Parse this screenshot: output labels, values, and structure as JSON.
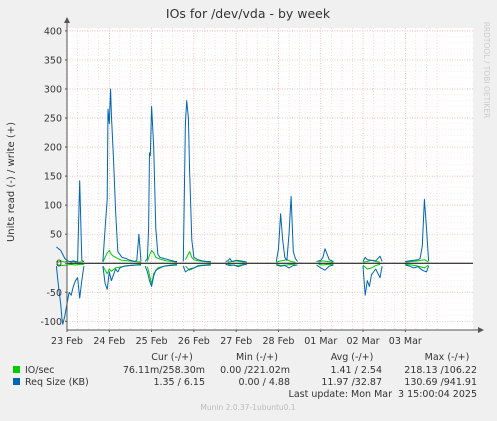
{
  "chart_data": {
    "type": "line",
    "title": "IOs for /dev/vda - by week",
    "ylabel": "Units read (-) / write (+)",
    "side_label": "RRDTOOL / TOBI OETIKER",
    "ylim": [
      -115,
      405
    ],
    "yticks": [
      -100,
      -50,
      0,
      50,
      100,
      150,
      200,
      250,
      300,
      350,
      400
    ],
    "xlim": [
      0,
      9.6
    ],
    "xticks": [
      {
        "x": 0,
        "label": "23 Feb"
      },
      {
        "x": 1,
        "label": "24 Feb"
      },
      {
        "x": 2,
        "label": "25 Feb"
      },
      {
        "x": 3,
        "label": "26 Feb"
      },
      {
        "x": 4,
        "label": "27 Feb"
      },
      {
        "x": 5,
        "label": "28 Feb"
      },
      {
        "x": 6,
        "label": "01 Mar"
      },
      {
        "x": 7,
        "label": "02 Mar"
      },
      {
        "x": 8,
        "label": "03 Mar"
      }
    ],
    "series": [
      {
        "name": "IO/sec",
        "color": "#00cc00",
        "segments": [
          {
            "x": [
              -0.25,
              -0.2,
              -0.15,
              -0.1,
              -0.05,
              0.0,
              0.05,
              0.1,
              0.15,
              0.2,
              0.3,
              0.4
            ],
            "y": [
              3,
              2,
              4,
              3,
              2,
              4,
              3,
              2,
              3,
              2,
              2,
              3
            ]
          },
          {
            "x": [
              0.85,
              0.9,
              0.95,
              1.0,
              1.05,
              1.1,
              1.2,
              1.3,
              1.45,
              1.6,
              1.75
            ],
            "y": [
              2,
              10,
              18,
              22,
              15,
              12,
              8,
              5,
              4,
              3,
              2
            ]
          },
          {
            "x": [
              1.9,
              1.95,
              2.0,
              2.05,
              2.1,
              2.2,
              2.35,
              2.5,
              2.6
            ],
            "y": [
              3,
              14,
              22,
              18,
              10,
              7,
              4,
              3,
              2
            ]
          },
          {
            "x": [
              2.8,
              2.85,
              2.9,
              2.95,
              3.0,
              3.1,
              3.25,
              3.4
            ],
            "y": [
              6,
              13,
              20,
              10,
              6,
              4,
              3,
              2
            ]
          },
          {
            "x": [
              3.8,
              3.9,
              4.0,
              4.1,
              4.2
            ],
            "y": [
              2,
              3,
              4,
              3,
              2
            ]
          },
          {
            "x": [
              4.95,
              5.05,
              5.2,
              5.3,
              5.4
            ],
            "y": [
              2,
              4,
              6,
              3,
              2
            ]
          },
          {
            "x": [
              5.95,
              6.05,
              6.15,
              6.3
            ],
            "y": [
              2,
              4,
              3,
              2
            ]
          },
          {
            "x": [
              7.0,
              7.1,
              7.2,
              7.3,
              7.4
            ],
            "y": [
              2,
              3,
              5,
              3,
              2
            ]
          },
          {
            "x": [
              8.0,
              8.15,
              8.3,
              8.45,
              8.55
            ],
            "y": [
              2,
              3,
              4,
              6,
              2
            ]
          }
        ],
        "neg_segments": [
          {
            "x": [
              -0.25,
              -0.2,
              -0.1,
              0.0,
              0.1,
              0.2,
              0.3,
              0.4
            ],
            "y": [
              -2,
              -3,
              -4,
              -3,
              -2,
              -3,
              -2,
              -2
            ]
          },
          {
            "x": [
              0.85,
              0.95,
              1.0,
              1.05,
              1.15,
              1.3,
              1.45,
              1.6,
              1.75
            ],
            "y": [
              -5,
              -18,
              -10,
              -14,
              -8,
              -6,
              -4,
              -3,
              -2
            ]
          },
          {
            "x": [
              1.9,
              1.95,
              2.0,
              2.05,
              2.15,
              2.3,
              2.45,
              2.6
            ],
            "y": [
              -6,
              -20,
              -36,
              -18,
              -8,
              -5,
              -3,
              -2
            ]
          },
          {
            "x": [
              2.8,
              2.9,
              3.0,
              3.1,
              3.25,
              3.4
            ],
            "y": [
              -5,
              -12,
              -8,
              -4,
              -3,
              -2
            ]
          },
          {
            "x": [
              3.8,
              3.9,
              4.0,
              4.1,
              4.2
            ],
            "y": [
              -2,
              -3,
              -4,
              -3,
              -2
            ]
          },
          {
            "x": [
              4.95,
              5.05,
              5.2,
              5.3,
              5.4
            ],
            "y": [
              -2,
              -4,
              -3,
              -2,
              -2
            ]
          },
          {
            "x": [
              5.95,
              6.05,
              6.15,
              6.3
            ],
            "y": [
              -2,
              -3,
              -2,
              -2
            ]
          },
          {
            "x": [
              7.0,
              7.1,
              7.2,
              7.3,
              7.4
            ],
            "y": [
              -3,
              -10,
              -8,
              -4,
              -2
            ]
          },
          {
            "x": [
              8.0,
              8.15,
              8.3,
              8.45,
              8.55
            ],
            "y": [
              -2,
              -3,
              -5,
              -8,
              -3
            ]
          }
        ]
      },
      {
        "name": "Req Size (KB)",
        "color": "#0066b3",
        "segments": [
          {
            "x": [
              -0.25,
              -0.2,
              -0.15,
              -0.1,
              -0.05,
              0.0,
              0.05,
              0.1,
              0.15,
              0.2,
              0.25,
              0.3,
              0.35,
              0.4
            ],
            "y": [
              28,
              25,
              22,
              15,
              8,
              5,
              3,
              3,
              4,
              3,
              2,
              142,
              5,
              3
            ]
          },
          {
            "x": [
              0.85,
              0.9,
              0.95,
              0.97,
              1.0,
              1.03,
              1.05,
              1.1,
              1.15,
              1.2,
              1.3,
              1.4,
              1.45,
              1.5,
              1.55,
              1.6,
              1.65,
              1.7,
              1.75
            ],
            "y": [
              3,
              60,
              110,
              265,
              240,
              300,
              255,
              180,
              90,
              20,
              10,
              8,
              6,
              5,
              4,
              3,
              5,
              50,
              3
            ]
          },
          {
            "x": [
              1.85,
              1.9,
              1.93,
              1.95,
              1.97,
              2.0,
              2.05,
              2.1,
              2.15,
              2.2,
              2.3,
              2.4,
              2.5,
              2.55,
              2.6
            ],
            "y": [
              3,
              8,
              60,
              190,
              185,
              270,
              200,
              60,
              15,
              10,
              8,
              6,
              4,
              3,
              3
            ]
          },
          {
            "x": [
              2.75,
              2.8,
              2.83,
              2.87,
              2.9,
              2.95,
              3.0,
              3.1,
              3.2,
              3.3,
              3.4
            ],
            "y": [
              3,
              240,
              280,
              250,
              160,
              40,
              10,
              6,
              4,
              3,
              3
            ]
          },
          {
            "x": [
              3.75,
              3.8,
              3.85,
              3.9,
              4.0,
              4.1,
              4.2,
              4.25
            ],
            "y": [
              3,
              4,
              8,
              3,
              5,
              4,
              3,
              2
            ]
          },
          {
            "x": [
              4.95,
              5.0,
              5.05,
              5.1,
              5.15,
              5.2,
              5.25,
              5.3,
              5.35,
              5.4,
              5.45
            ],
            "y": [
              3,
              25,
              85,
              40,
              10,
              5,
              50,
              115,
              20,
              8,
              3
            ]
          },
          {
            "x": [
              5.9,
              6.0,
              6.05,
              6.1,
              6.2,
              6.3
            ],
            "y": [
              3,
              5,
              10,
              25,
              6,
              3
            ]
          },
          {
            "x": [
              7.0,
              7.05,
              7.1,
              7.2,
              7.3,
              7.4,
              7.45
            ],
            "y": [
              3,
              10,
              6,
              5,
              4,
              12,
              3
            ]
          },
          {
            "x": [
              8.0,
              8.1,
              8.2,
              8.3,
              8.35,
              8.4,
              8.45,
              8.5,
              8.55
            ],
            "y": [
              3,
              4,
              5,
              6,
              8,
              30,
              110,
              60,
              4
            ]
          }
        ],
        "neg_segments": [
          {
            "x": [
              -0.25,
              -0.2,
              -0.15,
              -0.12,
              -0.1,
              -0.05,
              0.0,
              0.05,
              0.1,
              0.15,
              0.2,
              0.25,
              0.3,
              0.35,
              0.4
            ],
            "y": [
              -5,
              -40,
              -70,
              -95,
              -105,
              -90,
              -70,
              -50,
              -55,
              -40,
              -30,
              -25,
              -60,
              -30,
              -5
            ]
          },
          {
            "x": [
              0.85,
              0.9,
              0.95,
              1.0,
              1.05,
              1.1,
              1.15,
              1.2,
              1.25,
              1.35,
              1.5,
              1.65,
              1.75
            ],
            "y": [
              -5,
              -35,
              -45,
              -15,
              -30,
              -20,
              -10,
              -15,
              -8,
              -5,
              -4,
              -3,
              -3
            ]
          },
          {
            "x": [
              1.85,
              1.9,
              1.95,
              2.0,
              2.05,
              2.1,
              2.2,
              2.3,
              2.45,
              2.6
            ],
            "y": [
              -5,
              -15,
              -30,
              -40,
              -22,
              -12,
              -8,
              -5,
              -4,
              -3
            ]
          },
          {
            "x": [
              2.75,
              2.8,
              2.9,
              3.0,
              3.1,
              3.2,
              3.4
            ],
            "y": [
              -5,
              -15,
              -10,
              -8,
              -5,
              -4,
              -3
            ]
          },
          {
            "x": [
              3.75,
              3.85,
              3.95,
              4.05,
              4.15,
              4.25
            ],
            "y": [
              -2,
              -4,
              -3,
              -6,
              -3,
              -2
            ]
          },
          {
            "x": [
              4.95,
              5.05,
              5.15,
              5.25,
              5.35,
              5.45
            ],
            "y": [
              -3,
              -5,
              -4,
              -8,
              -4,
              -3
            ]
          },
          {
            "x": [
              5.9,
              6.0,
              6.1,
              6.2,
              6.3
            ],
            "y": [
              -3,
              -8,
              -12,
              -5,
              -3
            ]
          },
          {
            "x": [
              7.0,
              7.05,
              7.1,
              7.15,
              7.2,
              7.3,
              7.4,
              7.45
            ],
            "y": [
              -5,
              -55,
              -30,
              -40,
              -20,
              -10,
              -25,
              -5
            ]
          },
          {
            "x": [
              8.0,
              8.1,
              8.2,
              8.3,
              8.4,
              8.5,
              8.55
            ],
            "y": [
              -3,
              -5,
              -8,
              -6,
              -12,
              -15,
              -5
            ]
          }
        ]
      }
    ]
  },
  "legend": {
    "headers": {
      "cur": "Cur (-/+)",
      "min": "Min (-/+)",
      "avg": "Avg (-/+)",
      "max": "Max (-/+)"
    },
    "rows": [
      {
        "color": "#00cc00",
        "name": "IO/sec",
        "cur": "76.11m/258.30m",
        "min": "0.00 /221.02m",
        "avg": "1.41 / 2.54",
        "max": "218.13 /106.22"
      },
      {
        "color": "#0066b3",
        "name": "Req Size (KB)",
        "cur": "1.35 / 6.15",
        "min": "0.00 / 4.88",
        "avg": "11.97 /32.87",
        "max": "130.69 /941.91"
      }
    ],
    "last_update": "Last update: Mon Mar  3 15:00:04 2025"
  },
  "footer": "Munin 2.0.37-1ubuntu0.1"
}
